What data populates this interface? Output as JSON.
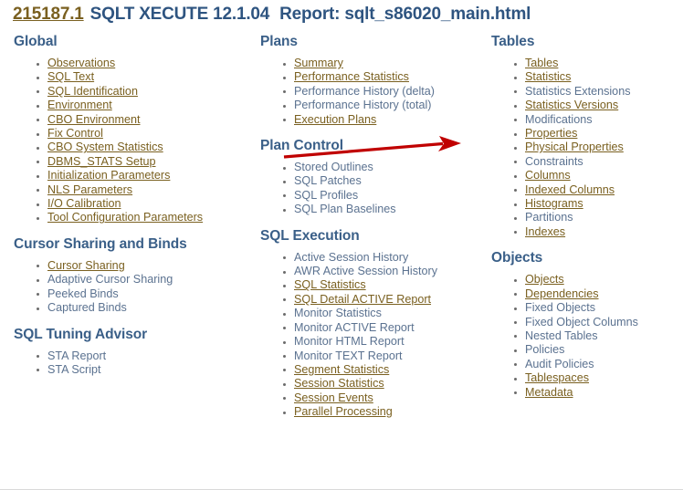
{
  "title": {
    "doc_id": "215187.1",
    "product": "SQLT XECUTE 12.1.04",
    "report": "Report: sqlt_s86020_main.html"
  },
  "colors": {
    "link": "#7a6020",
    "plain": "#5b7290",
    "heading": "#3a5f88",
    "title_main": "#2e5480",
    "arrow": "#c00000"
  },
  "annotation": {
    "arrow_target": "Execution Plans",
    "arrow_color": "#c00000"
  },
  "columns": [
    {
      "id": "column-global",
      "sections": [
        {
          "heading": "Global",
          "items": [
            {
              "label": "Observations",
              "link": true
            },
            {
              "label": "SQL Text",
              "link": true
            },
            {
              "label": "SQL Identification",
              "link": true
            },
            {
              "label": "Environment",
              "link": true
            },
            {
              "label": "CBO Environment",
              "link": true
            },
            {
              "label": "Fix Control",
              "link": true
            },
            {
              "label": "CBO System Statistics",
              "link": true
            },
            {
              "label": "DBMS_STATS Setup",
              "link": true
            },
            {
              "label": "Initialization Parameters",
              "link": true
            },
            {
              "label": "NLS Parameters",
              "link": true
            },
            {
              "label": "I/O Calibration",
              "link": true
            },
            {
              "label": "Tool Configuration Parameters",
              "link": true
            }
          ]
        },
        {
          "heading": "Cursor Sharing and Binds",
          "items": [
            {
              "label": "Cursor Sharing",
              "link": true
            },
            {
              "label": "Adaptive Cursor Sharing",
              "link": false
            },
            {
              "label": "Peeked Binds",
              "link": false
            },
            {
              "label": "Captured Binds",
              "link": false
            }
          ]
        },
        {
          "heading": "SQL Tuning Advisor",
          "items": [
            {
              "label": "STA Report",
              "link": false
            },
            {
              "label": "STA Script",
              "link": false
            }
          ]
        }
      ]
    },
    {
      "id": "column-plans",
      "sections": [
        {
          "heading": "Plans",
          "items": [
            {
              "label": "Summary",
              "link": true
            },
            {
              "label": "Performance Statistics",
              "link": true
            },
            {
              "label": "Performance History (delta)",
              "link": false
            },
            {
              "label": "Performance History (total)",
              "link": false
            },
            {
              "label": "Execution Plans",
              "link": true
            }
          ]
        },
        {
          "heading": "Plan Control",
          "items": [
            {
              "label": "Stored Outlines",
              "link": false
            },
            {
              "label": "SQL Patches",
              "link": false
            },
            {
              "label": "SQL Profiles",
              "link": false
            },
            {
              "label": "SQL Plan Baselines",
              "link": false
            }
          ]
        },
        {
          "heading": "SQL Execution",
          "items": [
            {
              "label": "Active Session History",
              "link": false
            },
            {
              "label": "AWR Active Session History",
              "link": false
            },
            {
              "label": "SQL Statistics",
              "link": true
            },
            {
              "label": "SQL Detail ACTIVE Report",
              "link": true
            },
            {
              "label": "Monitor Statistics",
              "link": false
            },
            {
              "label": "Monitor ACTIVE Report",
              "link": false
            },
            {
              "label": "Monitor HTML Report",
              "link": false
            },
            {
              "label": "Monitor TEXT Report",
              "link": false
            },
            {
              "label": "Segment Statistics",
              "link": true
            },
            {
              "label": "Session Statistics",
              "link": true
            },
            {
              "label": "Session Events",
              "link": true
            },
            {
              "label": "Parallel Processing",
              "link": true
            }
          ]
        }
      ]
    },
    {
      "id": "column-tables",
      "sections": [
        {
          "heading": "Tables",
          "items": [
            {
              "label": "Tables",
              "link": true
            },
            {
              "label": "Statistics",
              "link": true
            },
            {
              "label": "Statistics Extensions",
              "link": false
            },
            {
              "label": "Statistics Versions",
              "link": true
            },
            {
              "label": "Modifications",
              "link": false
            },
            {
              "label": "Properties",
              "link": true
            },
            {
              "label": "Physical Properties",
              "link": true
            },
            {
              "label": "Constraints",
              "link": false
            },
            {
              "label": "Columns",
              "link": true
            },
            {
              "label": "Indexed Columns",
              "link": true
            },
            {
              "label": "Histograms",
              "link": true
            },
            {
              "label": "Partitions",
              "link": false
            },
            {
              "label": "Indexes",
              "link": true
            }
          ]
        },
        {
          "heading": "Objects",
          "items": [
            {
              "label": "Objects",
              "link": true
            },
            {
              "label": "Dependencies",
              "link": true
            },
            {
              "label": "Fixed Objects",
              "link": false
            },
            {
              "label": "Fixed Object Columns",
              "link": false
            },
            {
              "label": "Nested Tables",
              "link": false
            },
            {
              "label": "Policies",
              "link": false
            },
            {
              "label": "Audit Policies",
              "link": false
            },
            {
              "label": "Tablespaces",
              "link": true
            },
            {
              "label": "Metadata",
              "link": true
            }
          ]
        }
      ]
    }
  ]
}
